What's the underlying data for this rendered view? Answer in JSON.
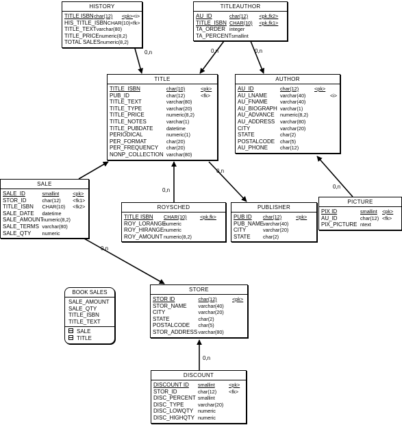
{
  "entities": [
    {
      "id": "history",
      "name": "HISTORY",
      "cols": [
        64,
        60,
        20,
        10
      ],
      "rows": [
        {
          "name": "TITLE ISBN",
          "type": "char(12)",
          "key": "<pk>",
          "extra": "<i>",
          "pk": true
        },
        {
          "name": "HIS_TITLE_ISBN",
          "type": "CHAR(10)",
          "key": "<fk>",
          "extra": ""
        },
        {
          "name": "TITLE_TEXT",
          "type": "varchar(80)",
          "key": "",
          "extra": ""
        },
        {
          "name": "TITLE_PRICE",
          "type": "numeric(8,2)",
          "key": "",
          "extra": ""
        },
        {
          "name": "TOTAL SALES",
          "type": "numeric(8,2)",
          "key": "",
          "extra": ""
        }
      ]
    },
    {
      "id": "titleauthor",
      "name": "TITLEAUTHOR",
      "cols": [
        52,
        46,
        40,
        0
      ],
      "rows": [
        {
          "name": "AU_ID",
          "type": "char(12)",
          "key": "<pk,fk2>",
          "extra": "",
          "pk": true
        },
        {
          "name": "TITLE_ISBN",
          "type": "CHAR(10)",
          "key": "<pk,fk1>",
          "extra": "",
          "pk": true
        },
        {
          "name": "TA_ORDER",
          "type": "integer",
          "key": "",
          "extra": ""
        },
        {
          "name": "TA_PERCENT",
          "type": "smallint",
          "key": "",
          "extra": ""
        }
      ]
    },
    {
      "id": "title",
      "name": "TITLE",
      "cols": [
        83,
        50,
        20,
        0
      ],
      "rows": [
        {
          "name": "TITLE_ISBN",
          "type": "char(10)",
          "key": "<pk>",
          "extra": "",
          "pk": true
        },
        {
          "name": "PUB_ID",
          "type": "char(12)",
          "key": "<fk>",
          "extra": ""
        },
        {
          "name": "TITLE_TEXT",
          "type": "varchar(80)",
          "key": "",
          "extra": ""
        },
        {
          "name": "TITLE_TYPE",
          "type": "varchar(20)",
          "key": "",
          "extra": ""
        },
        {
          "name": "TITLE_PRICE",
          "type": "numeric(8,2)",
          "key": "",
          "extra": ""
        },
        {
          "name": "TITLE_NOTES",
          "type": "varchar(1)",
          "key": "",
          "extra": ""
        },
        {
          "name": "TITLE_PUBDATE",
          "type": "datetime",
          "key": "",
          "extra": ""
        },
        {
          "name": "PERIODICAL",
          "type": "numeric(1)",
          "key": "",
          "extra": ""
        },
        {
          "name": "PER_FORMAT",
          "type": "char(20)",
          "key": "",
          "extra": ""
        },
        {
          "name": "PER_FREQUENCY",
          "type": "char(20)",
          "key": "",
          "extra": ""
        },
        {
          "name": "NONP_COLLECTION",
          "type": "varchar(80)",
          "key": "",
          "extra": ""
        }
      ]
    },
    {
      "id": "author",
      "name": "AUTHOR",
      "cols": [
        62,
        50,
        23,
        10
      ],
      "rows": [
        {
          "name": "AU_ID",
          "type": "char(12)",
          "key": "<pk>",
          "extra": "",
          "pk": true
        },
        {
          "name": "AU_LNAME",
          "type": "varchar(40)",
          "key": "",
          "extra": "<i>"
        },
        {
          "name": "AU_FNAME",
          "type": "varchar(40)",
          "key": "",
          "extra": ""
        },
        {
          "name": "AU_BIOGRAPH",
          "type": "varchar(1)",
          "key": "",
          "extra": ""
        },
        {
          "name": "AU_ADVANCE",
          "type": "numeric(8,2)",
          "key": "",
          "extra": ""
        },
        {
          "name": "AU_ADDRESS",
          "type": "varchar(80)",
          "key": "",
          "extra": ""
        },
        {
          "name": "CITY",
          "type": "varchar(20)",
          "key": "",
          "extra": ""
        },
        {
          "name": "STATE",
          "type": "char(2)",
          "key": "",
          "extra": ""
        },
        {
          "name": "POSTALCODE",
          "type": "char(5)",
          "key": "",
          "extra": ""
        },
        {
          "name": "AU_PHONE",
          "type": "char(12)",
          "key": "",
          "extra": ""
        }
      ]
    },
    {
      "id": "sale",
      "name": "SALE",
      "cols": [
        58,
        45,
        20,
        0
      ],
      "rows": [
        {
          "name": "SALE_ID",
          "type": "smallint",
          "key": "<pk>",
          "extra": "",
          "pk": true
        },
        {
          "name": "STOR_ID",
          "type": "char(12)",
          "key": "<fk1>",
          "extra": ""
        },
        {
          "name": "TITLE_ISBN",
          "type": "CHAR(10)",
          "key": "<fk2>",
          "extra": ""
        },
        {
          "name": "SALE_DATE",
          "type": "datetime",
          "key": "",
          "extra": ""
        },
        {
          "name": "SALE_AMOUNT",
          "type": "numeric(8,2)",
          "key": "",
          "extra": ""
        },
        {
          "name": "SALE_TERMS",
          "type": "varchar(80)",
          "key": "",
          "extra": ""
        },
        {
          "name": "SALE_QTY",
          "type": "numeric",
          "key": "",
          "extra": ""
        }
      ]
    },
    {
      "id": "roysched",
      "name": "ROYSCHED",
      "cols": [
        58,
        53,
        30,
        0
      ],
      "rows": [
        {
          "name": "TITLE ISBN",
          "type": "CHAR(10)",
          "key": "<pk,fk>",
          "extra": "",
          "pk": true
        },
        {
          "name": "ROY_LORANGE",
          "type": "numeric",
          "key": "",
          "extra": ""
        },
        {
          "name": "ROY_HIRANGE",
          "type": "numeric",
          "key": "",
          "extra": ""
        },
        {
          "name": "ROY_AMOUNT",
          "type": "numeric(8,2)",
          "key": "",
          "extra": ""
        }
      ]
    },
    {
      "id": "publisher",
      "name": "PUBLISHER",
      "cols": [
        43,
        48,
        20,
        0
      ],
      "rows": [
        {
          "name": "PUB ID",
          "type": "char(12)",
          "key": "<pk>",
          "extra": "",
          "pk": true
        },
        {
          "name": "PUB_NAME",
          "type": "varchar(40)",
          "key": "",
          "extra": ""
        },
        {
          "name": "CITY",
          "type": "varchar(20)",
          "key": "",
          "extra": ""
        },
        {
          "name": "STATE",
          "type": "char(2)",
          "key": "",
          "extra": ""
        }
      ]
    },
    {
      "id": "picture",
      "name": "PICTURE",
      "cols": [
        57,
        32,
        18,
        0
      ],
      "rows": [
        {
          "name": "PIX ID",
          "type": "smallint",
          "key": "<pk>",
          "extra": "",
          "pk": true
        },
        {
          "name": "AU_ID",
          "type": "char(12)",
          "key": "<fk>",
          "extra": ""
        },
        {
          "name": "PIX_PICTURE",
          "type": "ntext",
          "key": "",
          "extra": ""
        }
      ]
    },
    {
      "id": "store",
      "name": "STORE",
      "cols": [
        70,
        52,
        20,
        0
      ],
      "rows": [
        {
          "name": "STOR ID",
          "type": "char(12)",
          "key": "<pk>",
          "extra": "",
          "pk": true
        },
        {
          "name": "STOR_NAME",
          "type": "varchar(40)",
          "key": "",
          "extra": ""
        },
        {
          "name": "CITY",
          "type": "varchar(20)",
          "key": "",
          "extra": ""
        },
        {
          "name": "STATE",
          "type": "char(2)",
          "key": "",
          "extra": ""
        },
        {
          "name": "POSTALCODE",
          "type": "char(5)",
          "key": "",
          "extra": ""
        },
        {
          "name": "STOR_ADDRESS",
          "type": "varchar(80)",
          "key": "",
          "extra": ""
        }
      ]
    },
    {
      "id": "discount",
      "name": "DISCOUNT",
      "cols": [
        65,
        45,
        20,
        0
      ],
      "rows": [
        {
          "name": "DISCOUNT ID",
          "type": "smallint",
          "key": "<pk>",
          "extra": "",
          "pk": true
        },
        {
          "name": "STOR_ID",
          "type": "char(12)",
          "key": "<fk>",
          "extra": ""
        },
        {
          "name": "DISC_PERCENT",
          "type": "smallint",
          "key": "",
          "extra": ""
        },
        {
          "name": "DISC_TYPE",
          "type": "varchar(20)",
          "key": "",
          "extra": ""
        },
        {
          "name": "DISC_LOWQTY",
          "type": "numeric",
          "key": "",
          "extra": ""
        },
        {
          "name": "DISC_HIGHQTY",
          "type": "numeric",
          "key": "",
          "extra": ""
        }
      ]
    }
  ],
  "view": {
    "name": "BOOK SALES",
    "columns": [
      "SALE_AMOUNT",
      "SALE_QTY",
      "TITLE_ISBN",
      "TITLE_TEXT"
    ],
    "tables": [
      "SALE",
      "TITLE"
    ],
    "table_icon": "table-icon"
  },
  "relationships": [
    {
      "from": "history",
      "to": "title",
      "cardinality": "0,n"
    },
    {
      "from": "titleauthor",
      "to": "title",
      "cardinality": "0,n"
    },
    {
      "from": "titleauthor",
      "to": "author",
      "cardinality": "0,n"
    },
    {
      "from": "sale",
      "to": "title",
      "cardinality": ""
    },
    {
      "from": "roysched",
      "to": "title",
      "cardinality": "0,n"
    },
    {
      "from": "title",
      "to": "publisher",
      "cardinality": "0,n"
    },
    {
      "from": "picture",
      "to": "author",
      "cardinality": "0,n"
    },
    {
      "from": "sale",
      "to": "store",
      "cardinality": "0,n"
    },
    {
      "from": "discount",
      "to": "store",
      "cardinality": "0,n"
    }
  ]
}
